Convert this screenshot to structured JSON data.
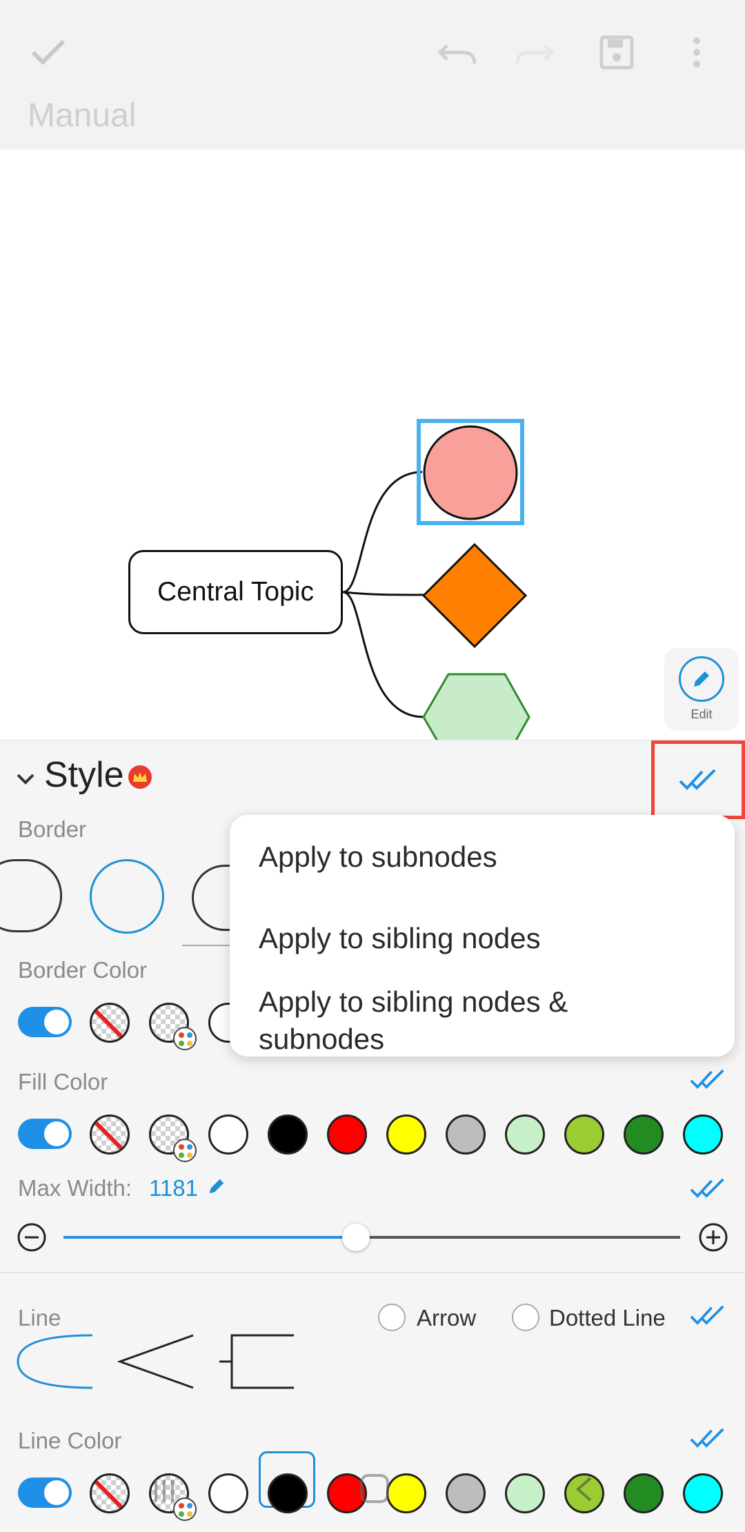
{
  "toolbar": {
    "title": "Manual",
    "icons": [
      "check-icon",
      "undo-icon",
      "redo-icon",
      "save-icon",
      "more-icon"
    ]
  },
  "canvas": {
    "central_topic": "Central Topic",
    "nodes": [
      {
        "shape": "circle",
        "fill": "#f9a09a",
        "stroke": "#111111",
        "selected": true
      },
      {
        "shape": "diamond",
        "fill": "#ff7f00",
        "stroke": "#111111"
      },
      {
        "shape": "hexagon",
        "fill": "#c8ecc9",
        "stroke": "#2e8b2e"
      }
    ],
    "edit_button": "Edit"
  },
  "style_panel": {
    "title": "Style",
    "border_label": "Border",
    "border_color_label": "Border Color",
    "fill_color_label": "Fill Color",
    "max_width_label": "Max Width:",
    "max_width_value": "1181",
    "line_label": "Line",
    "arrow_label": "Arrow",
    "dotted_line_label": "Dotted Line",
    "line_color_label": "Line Color",
    "colors": [
      "#ffffff",
      "#000000",
      "#ff0000",
      "#ffff00",
      "#bdbdbd",
      "#c8f0c8",
      "#9acd32",
      "#228b22",
      "#00ffff"
    ],
    "line_selected_color": "#000000",
    "accent": "#1e90e6"
  },
  "apply_menu": {
    "items": [
      "Apply to subnodes",
      "Apply to sibling nodes",
      "Apply to sibling nodes & subnodes"
    ]
  }
}
